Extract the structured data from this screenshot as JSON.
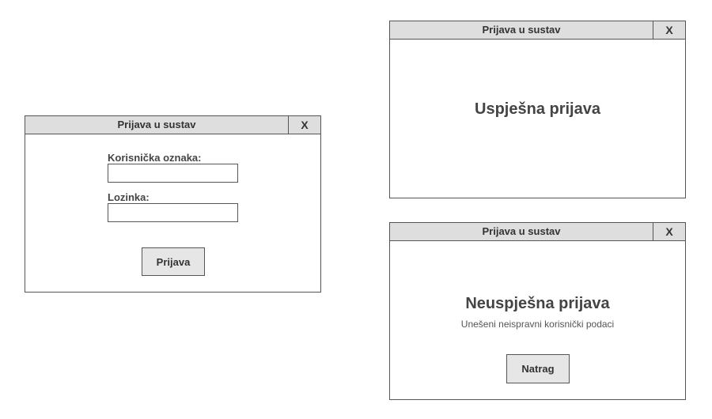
{
  "login_dialog": {
    "title": "Prijava u sustav",
    "close_label": "X",
    "username_label": "Korisnička oznaka:",
    "username_value": "",
    "password_label": "Lozinka:",
    "password_value": "",
    "submit_label": "Prijava"
  },
  "success_dialog": {
    "title": "Prijava u sustav",
    "close_label": "X",
    "message": "Uspješna prijava"
  },
  "failure_dialog": {
    "title": "Prijava u sustav",
    "close_label": "X",
    "message": "Neuspješna prijava",
    "detail": "Unešeni neispravni korisnički podaci",
    "back_label": "Natrag"
  }
}
